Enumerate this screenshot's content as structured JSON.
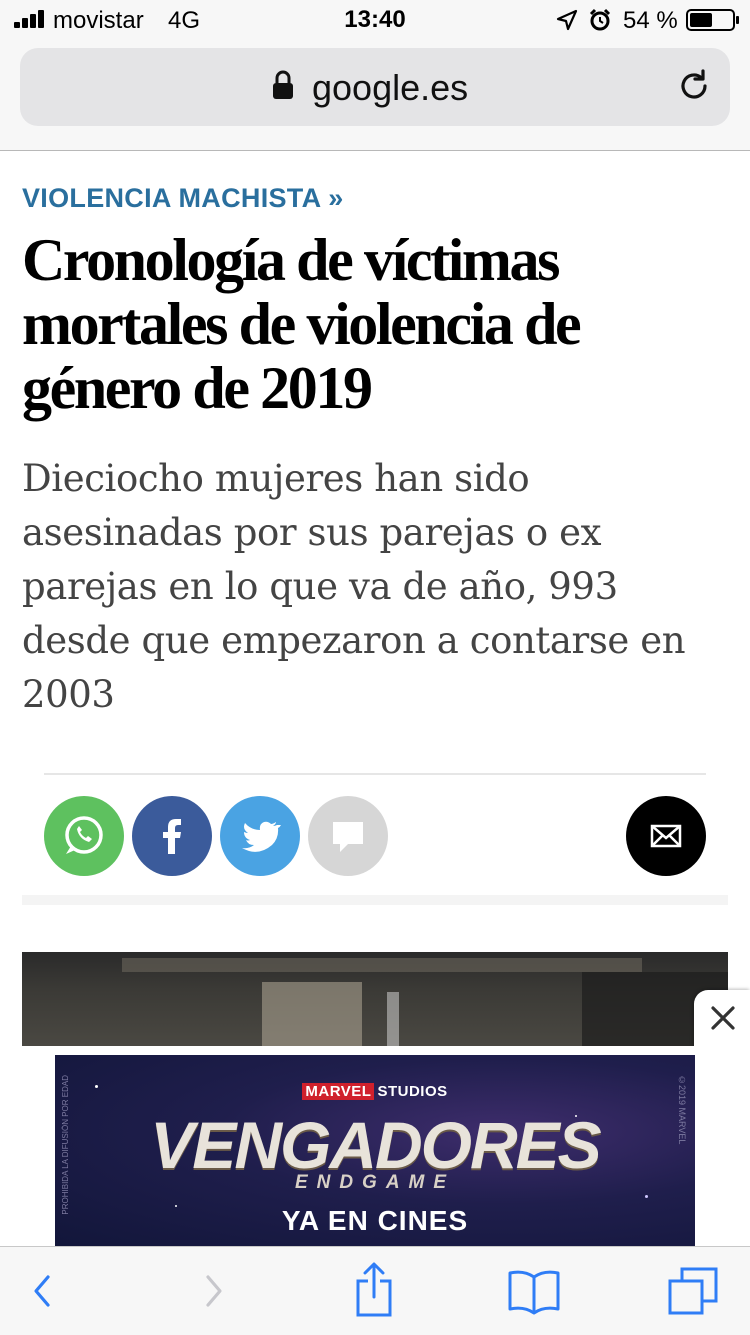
{
  "status_bar": {
    "carrier": "movistar",
    "network": "4G",
    "time": "13:40",
    "battery": "54 %",
    "battery_level": 0.54
  },
  "address_bar": {
    "url": "google.es"
  },
  "article": {
    "section": "VIOLENCIA MACHISTA »",
    "headline": "Cronología de víctimas mortales de violencia de género de 2019",
    "subheadline": "Dieciocho mujeres han sido asesinadas por sus parejas o ex parejas en lo que va de año, 993 desde que empezaron a contarse en 2003"
  },
  "share": {
    "buttons": [
      {
        "icon": "whatsapp-icon",
        "color": "#5ec15f"
      },
      {
        "icon": "facebook-icon",
        "color": "#3b5b9b"
      },
      {
        "icon": "twitter-icon",
        "color": "#4aa3e3"
      },
      {
        "icon": "comment-icon",
        "color": "#d6d6d6"
      },
      {
        "icon": "mail-icon",
        "color": "#000000"
      }
    ]
  },
  "ad": {
    "studio": "MARVEL STUDIOS",
    "studio_badge": "MARVEL",
    "studio_rest": "STUDIOS",
    "title": "VENGADORES",
    "subtitle": "ENDGAME",
    "cta": "YA EN CINES",
    "side_left": "PROHIBIDA LA DIFUSIÓN POR EDAD",
    "side_right": "©2019 MARVEL"
  },
  "colors": {
    "accent_link": "#2a6f9e",
    "toolbar_icon": "#2f7df6",
    "toolbar_icon_disabled": "#c7c7cc"
  },
  "toolbar": {
    "items": [
      "back-icon",
      "forward-icon",
      "share-icon",
      "bookmarks-icon",
      "tabs-icon"
    ]
  }
}
